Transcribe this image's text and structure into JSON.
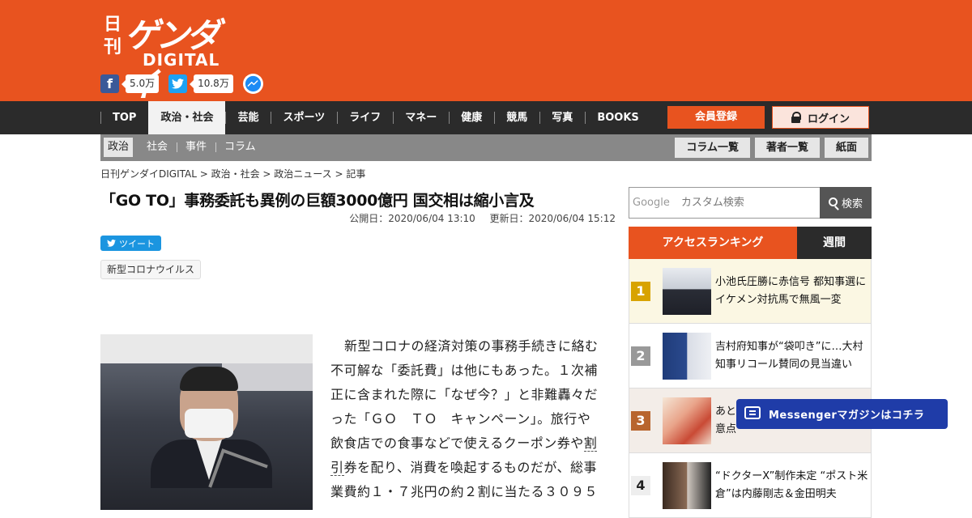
{
  "logo": {
    "kanji": "日刊",
    "kana": "ゲンダイ",
    "sub": "DIGITAL"
  },
  "share": {
    "facebook_count": "5.0万",
    "twitter_count": "10.8万"
  },
  "nav": {
    "items": [
      "TOP",
      "政治・社会",
      "芸能",
      "スポーツ",
      "ライフ",
      "マネー",
      "健康",
      "競馬",
      "写真",
      "BOOKS"
    ],
    "active": "政治・社会",
    "member_label": "会員登録",
    "login_label": "ログイン"
  },
  "subnav": {
    "items": [
      "政治",
      "社会",
      "事件",
      "コラム"
    ],
    "buttons": [
      "コラム一覧",
      "著者一覧",
      "紙面"
    ]
  },
  "breadcrumb": "日刊ゲンダイDIGITAL > 政治・社会 > 政治ニュース > 記事",
  "article": {
    "title": "「GO TO」事務委託も異例の巨額3000億円 国交相は縮小言及",
    "published": "公開日：2020/06/04 13:10",
    "updated": "更新日：2020/06/04 15:12",
    "tweet_label": "ツイート",
    "tag": "新型コロナウイルス",
    "lines": [
      "新型コロナの経済対策の事務手続きに絡む",
      "不可解な「委託費」は他にもあった。１次補",
      "正に含まれた際に「なぜ今？」と非難轟々だ",
      "った「ＧＯ　ＴＯ　キャンペーン」。旅行や",
      "飲食店での食事などで使えるクーポン券や",
      "券を配り、消費を喚起するものだが、総事",
      "業費約１・７兆円の約２割に当たる３０９５"
    ],
    "underlined": [
      "割",
      "引"
    ]
  },
  "search": {
    "google_label": "Google",
    "placeholder": "カスタム検索",
    "button": "検索"
  },
  "ranking": {
    "tab_access": "アクセスランキング",
    "tab_weekly": "週間",
    "items": [
      {
        "rank": "1",
        "title": "小池氏圧勝に赤信号 都知事選にイケメン対抗馬で無風一変"
      },
      {
        "rank": "2",
        "title": "吉村府知事が“袋叩き”に…大村知事リコール賛同の見当違い"
      },
      {
        "rank": "3",
        "title": "あと…ら貯金を引き出す際の注意点"
      },
      {
        "rank": "4",
        "title": "“ドクターX”制作未定 “ポスト米倉”は内藤剛志＆金田明夫"
      }
    ]
  },
  "messenger": {
    "label": "Messengerマガジンはコチラ"
  }
}
